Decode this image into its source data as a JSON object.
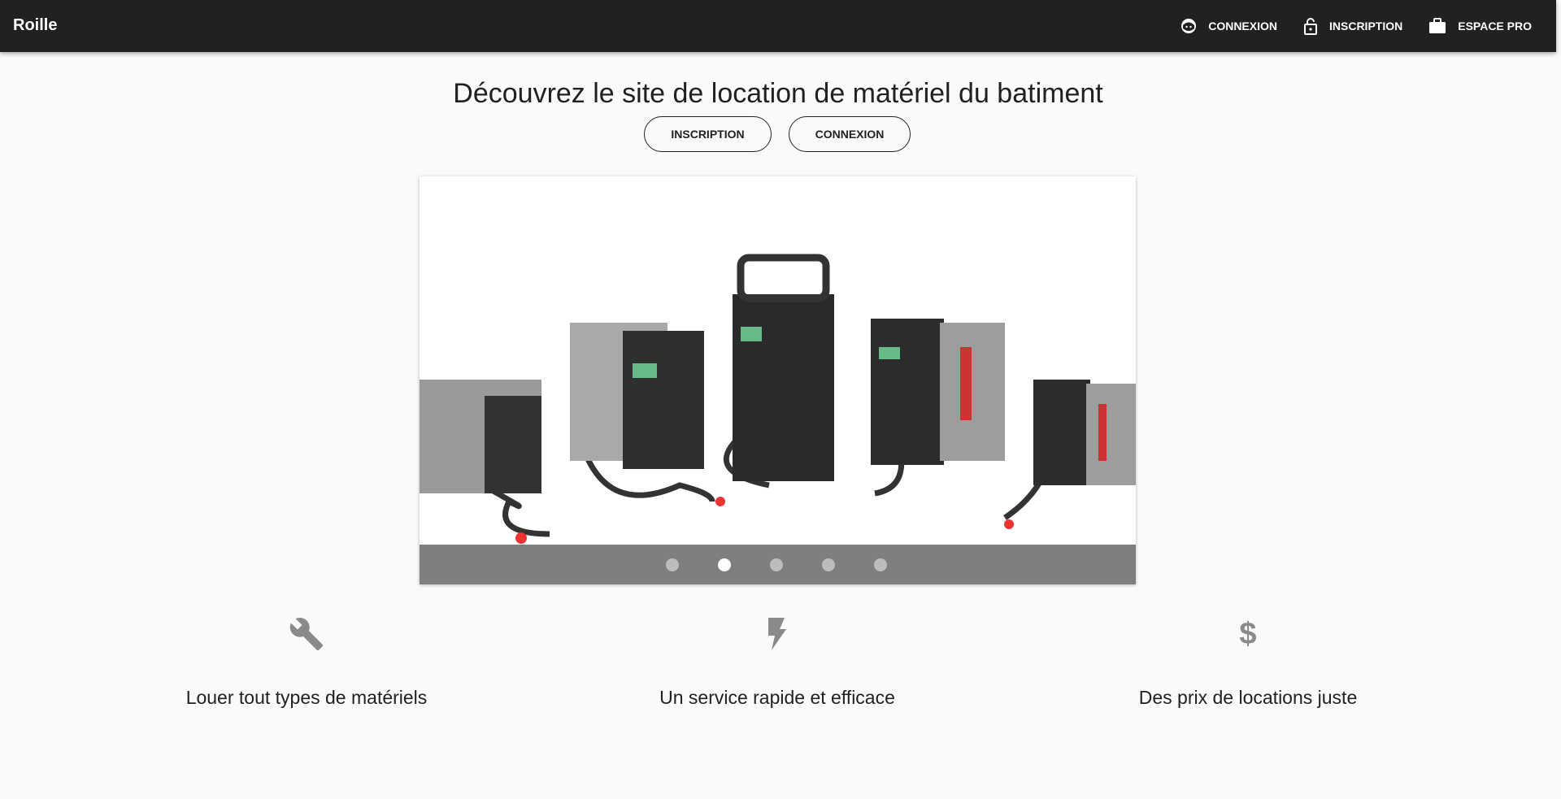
{
  "nav": {
    "brand": "Roille",
    "items": [
      {
        "label": "CONNEXION",
        "icon": "face-icon"
      },
      {
        "label": "INSCRIPTION",
        "icon": "lock-open-icon"
      },
      {
        "label": "ESPACE PRO",
        "icon": "briefcase-icon"
      }
    ]
  },
  "hero": {
    "title": "Découvrez le site de location de matériel du batiment",
    "inscription": "INSCRIPTION",
    "connexion": "CONNEXION"
  },
  "carousel": {
    "slides": 5,
    "active_index": 1,
    "prev": "‹",
    "next": "›"
  },
  "features": [
    {
      "icon": "wrench-icon",
      "text": "Louer tout types de matériels"
    },
    {
      "icon": "flash-icon",
      "text": "Un service rapide et efficace"
    },
    {
      "icon": "dollar-icon",
      "text": "Des prix de locations juste"
    }
  ]
}
